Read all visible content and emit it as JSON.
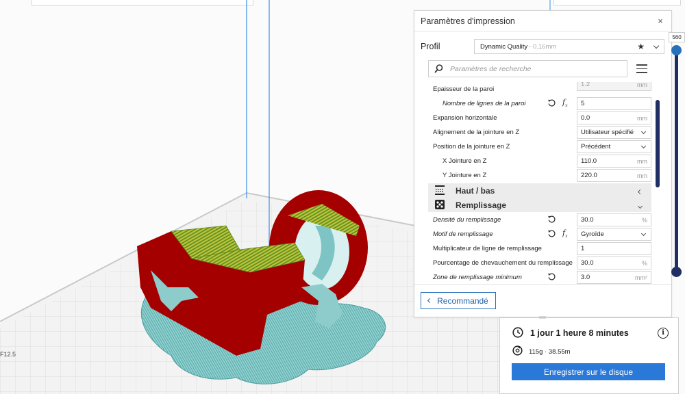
{
  "viewport": {
    "coord_label": "F12.5"
  },
  "settings_panel": {
    "title": "Paramètres d'impression",
    "close_label": "×",
    "profile": {
      "label": "Profil",
      "name": "Dynamic Quality",
      "sub": "- 0.16mm"
    },
    "search": {
      "placeholder": "Paramètres de recherche"
    },
    "rows": [
      {
        "label": "Epaisseur de la paroi",
        "value": "1.2",
        "unit": "mm",
        "type": "text",
        "disabled": true
      },
      {
        "label": "Nombre de lignes de la paroi",
        "value": "5",
        "unit": "",
        "type": "text",
        "italic": true,
        "indent": true,
        "reset": true,
        "fx": true
      },
      {
        "label": "Expansion horizontale",
        "value": "0.0",
        "unit": "mm",
        "type": "text"
      },
      {
        "label": "Alignement de la jointure en Z",
        "value": "Utilisateur spécifié",
        "type": "select"
      },
      {
        "label": "Position de la jointure en Z",
        "value": "Précédent",
        "type": "select"
      },
      {
        "label": "X Jointure en Z",
        "value": "110.0",
        "unit": "mm",
        "type": "text",
        "indent": true
      },
      {
        "label": "Y Jointure en Z",
        "value": "220.0",
        "unit": "mm",
        "type": "text",
        "indent": true
      }
    ],
    "categories": {
      "top_bottom": "Haut / bas",
      "infill": "Remplissage"
    },
    "infill_rows": [
      {
        "label": "Densité du remplissage",
        "value": "30.0",
        "unit": "%",
        "type": "text",
        "italic": true,
        "reset": true
      },
      {
        "label": "Motif de remplissage",
        "value": "Gyroïde",
        "type": "select",
        "italic": true,
        "reset": true,
        "fx": true
      },
      {
        "label": "Multiplicateur de ligne de remplissage",
        "value": "1",
        "unit": "",
        "type": "text"
      },
      {
        "label": "Pourcentage de chevauchement du remplissage",
        "value": "30.0",
        "unit": "%",
        "type": "text"
      },
      {
        "label": "Zone de remplissage minimum",
        "value": "3.0",
        "unit": "mm²",
        "type": "text",
        "italic": true,
        "reset": true
      }
    ],
    "recommend_button": "Recommandé"
  },
  "layer_slider": {
    "layer_number": "560"
  },
  "print_info": {
    "time": "1 jour 1 heure 8 minutes",
    "material": "115g · 38.55m",
    "save_button": "Enregistrer sur le disque"
  },
  "colors": {
    "accent": "#2a78d8",
    "model_red": "#a50000",
    "infill_yellow": "#c8c838",
    "support_cyan": "#7fc4c4"
  }
}
